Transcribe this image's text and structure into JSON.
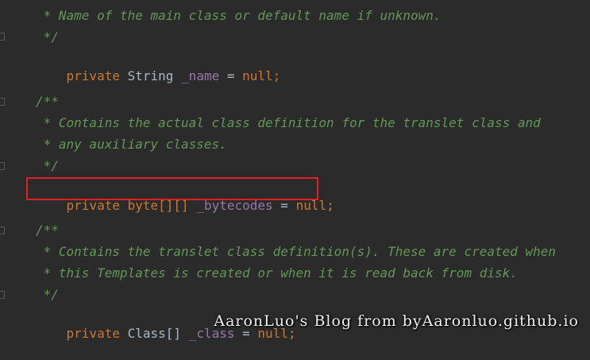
{
  "code": {
    "line1": " * Name of the main class or default name if unknown.",
    "line2": " */",
    "line3": {
      "kw": "private",
      "type": "String",
      "name": "_name",
      "op": "=",
      "val": "null",
      "end": ";"
    },
    "line4": "/**",
    "line5": " * Contains the actual class definition for the translet class and",
    "line6": " * any auxiliary classes.",
    "line7": " */",
    "line8": {
      "kw": "private",
      "type": "byte[][]",
      "name": "_bytecodes",
      "op": "=",
      "val": "null",
      "end": ";"
    },
    "line9": "/**",
    "line10": " * Contains the translet class definition(s). These are created when",
    "line11": " * this Templates is created or when it is read back from disk.",
    "line12": " */",
    "line13": {
      "kw": "private",
      "type": "Class[]",
      "name": "_class",
      "op": "=",
      "val": "null",
      "end": ";"
    }
  },
  "watermark": "AaronLuo's Blog from byAaronluo.github.io",
  "colors": {
    "background": "#2b2b2b",
    "comment": "#629755",
    "keyword": "#cc7832",
    "field": "#9876aa",
    "text": "#a9b7c6",
    "highlight_box": "#e02020"
  }
}
